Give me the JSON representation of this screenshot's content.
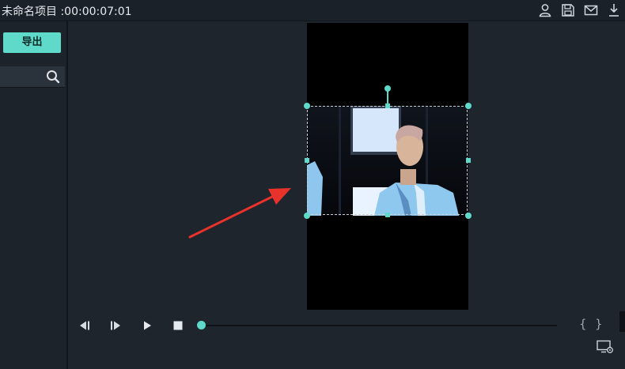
{
  "titlebar": {
    "title": "未命名项目 :00:00:07:01",
    "icons": [
      "user-icon",
      "save-icon",
      "mail-icon",
      "download-icon"
    ]
  },
  "left_panel": {
    "export_label": "导出",
    "search": {
      "value": "",
      "placeholder": "",
      "icon": "search-icon"
    }
  },
  "player": {
    "controls": [
      "prev-frame-icon",
      "next-frame-icon",
      "play-icon",
      "stop-icon"
    ],
    "progress": 0,
    "mark_in": "{",
    "mark_out": "}",
    "settings_icon": "monitor-settings-icon"
  },
  "colors": {
    "accent": "#5fd9c9",
    "background": "#1d232b",
    "canvas": "#000000",
    "arrow": "#e8322b"
  }
}
